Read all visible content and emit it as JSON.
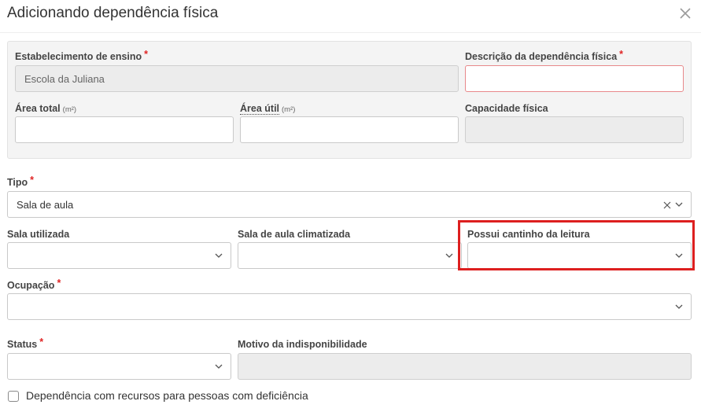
{
  "dialog": {
    "title": "Adicionando dependência física",
    "close_icon": "close-icon"
  },
  "panel": {
    "estabelecimento": {
      "label": "Estabelecimento de ensino",
      "required": "*",
      "value": "Escola da Juliana"
    },
    "descricao": {
      "label": "Descrição da dependência física",
      "required": "*",
      "value": ""
    },
    "area_total": {
      "label": "Área total",
      "unit": "(m²)",
      "value": ""
    },
    "area_util": {
      "label": "Área útil",
      "unit": "(m²)",
      "value": ""
    },
    "capacidade": {
      "label": "Capacidade física",
      "value": ""
    }
  },
  "form": {
    "tipo": {
      "label": "Tipo",
      "required": "*",
      "value": "Sala de aula"
    },
    "sala_utilizada": {
      "label": "Sala utilizada",
      "value": ""
    },
    "sala_climatizada": {
      "label": "Sala de aula climatizada",
      "value": ""
    },
    "cantinho_leitura": {
      "label": "Possui cantinho da leitura",
      "value": ""
    },
    "ocupacao": {
      "label": "Ocupação",
      "required": "*",
      "value": ""
    },
    "status": {
      "label": "Status",
      "required": "*",
      "value": ""
    },
    "motivo": {
      "label": "Motivo da indisponibilidade",
      "value": ""
    },
    "acessibilidade": {
      "label": "Dependência com recursos para pessoas com deficiência",
      "checked": false
    }
  },
  "colors": {
    "required": "#e02424",
    "highlight": "#dd1f1f",
    "invalid_border": "#e8898b"
  }
}
